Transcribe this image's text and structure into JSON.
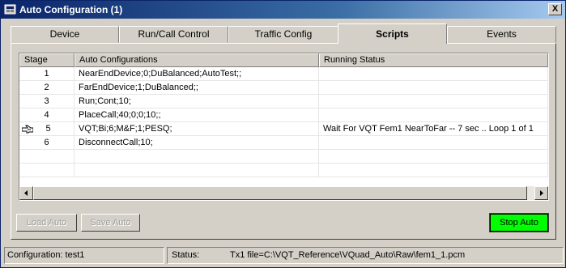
{
  "window": {
    "title": "Auto Configuration (1)",
    "close_label": "X"
  },
  "tabs": [
    {
      "label": "Device",
      "active": false
    },
    {
      "label": "Run/Call Control",
      "active": false
    },
    {
      "label": "Traffic Config",
      "active": false
    },
    {
      "label": "Scripts",
      "active": true
    },
    {
      "label": "Events",
      "active": false
    }
  ],
  "table": {
    "columns": [
      "Stage",
      "Auto Configurations",
      "Running Status"
    ],
    "rows": [
      {
        "stage": "1",
        "config": "NearEndDevice;0;DuBalanced;AutoTest;;",
        "status": "",
        "current": false
      },
      {
        "stage": "2",
        "config": "FarEndDevice;1;DuBalanced;;",
        "status": "",
        "current": false
      },
      {
        "stage": "3",
        "config": "Run;Cont;10;",
        "status": "",
        "current": false
      },
      {
        "stage": "4",
        "config": "PlaceCall;40;0;0;10;;",
        "status": "",
        "current": false
      },
      {
        "stage": "5",
        "config": "VQT;Bi;6;M&F;1;PESQ;",
        "status": "Wait For VQT Fem1 NearToFar -- 7 sec .. Loop 1 of 1",
        "current": true
      },
      {
        "stage": "6",
        "config": "DisconnectCall;10;",
        "status": "",
        "current": false
      }
    ]
  },
  "buttons": {
    "load_auto": "Load Auto",
    "save_auto": "Save Auto",
    "stop_auto": "Stop Auto"
  },
  "statusbar": {
    "configuration": "Configuration: test1",
    "status_label": "Status:",
    "status_value": "Tx1 file=C:\\VQT_Reference\\VQuad_Auto\\Raw\\fem1_1.pcm"
  },
  "colors": {
    "title_gradient_start": "#0a246a",
    "stop_button": "#00ff00"
  }
}
